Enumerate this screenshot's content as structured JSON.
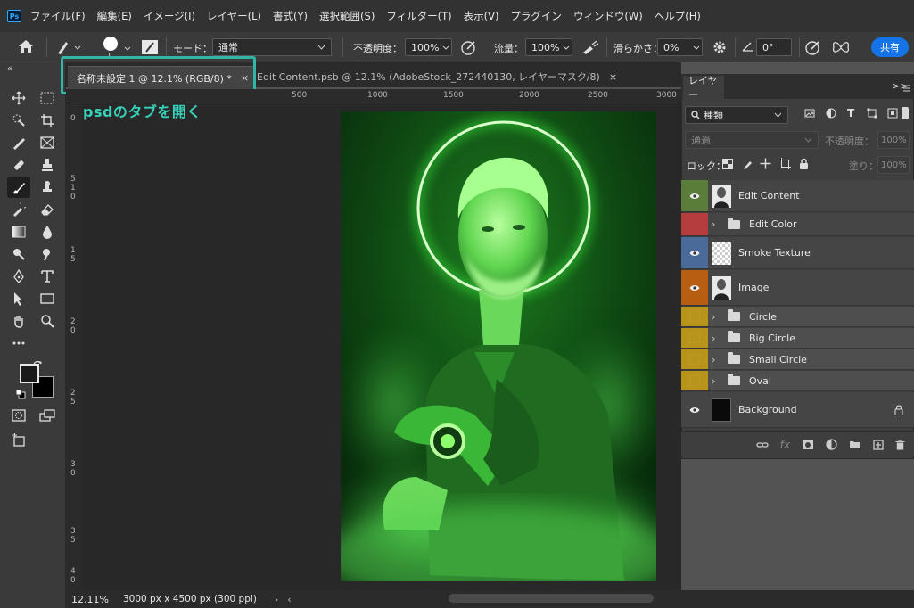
{
  "menubar": {
    "items": [
      "ファイル(F)",
      "編集(E)",
      "イメージ(I)",
      "レイヤー(L)",
      "書式(Y)",
      "選択範囲(S)",
      "フィルター(T)",
      "表示(V)",
      "プラグイン",
      "ウィンドウ(W)",
      "ヘルプ(H)"
    ],
    "logo_text": "Ps"
  },
  "options": {
    "brush_size": "1",
    "mode_label": "モード：",
    "mode_value": "通常",
    "opacity_label": "不透明度：",
    "opacity_value": "100%",
    "flow_label": "流量：",
    "flow_value": "100%",
    "smoothing_label": "滑らかさ：",
    "smoothing_value": "0%",
    "angle_value": "0°",
    "share_label": "共有"
  },
  "tabs": {
    "active": "名称未設定 1 @ 12.1% (RGB/8) *",
    "inactive": "Edit Content.psb @ 12.1% (AdobeStock_272440130, レイヤーマスク/8)",
    "close": "×",
    "collapse": "«"
  },
  "annotation": "psdのタブを開く",
  "ruler": {
    "top": [
      "500",
      "1000",
      "1500",
      "2000",
      "2500",
      "3000"
    ],
    "left": [
      "0",
      "5",
      "1",
      "0",
      "1",
      "5",
      "2",
      "0",
      "2",
      "5",
      "3",
      "0",
      "3",
      "5",
      "4",
      "0"
    ]
  },
  "status": {
    "zoom": "12.11%",
    "doc_info": "3000 px x 4500 px (300 ppi)",
    "arrow": "›",
    "left_arrow": "‹"
  },
  "layers_panel": {
    "title": "レイヤー",
    "menu": ">>",
    "filter_value": "種類",
    "blend_mode": "通過",
    "opacity_label": "不透明度：",
    "opacity_value": "100%",
    "lock_label": "ロック：",
    "fill_label": "塗り：",
    "fill_value": "100%",
    "layers": [
      {
        "name": "Edit Content",
        "color": "#5a7d3a",
        "type": "smart"
      },
      {
        "name": "Edit Color",
        "color": "#b53d3d",
        "type": "group"
      },
      {
        "name": "Smoke Texture",
        "color": "#4a6b9a",
        "type": "pixel"
      },
      {
        "name": "Image",
        "color": "#b85e12",
        "type": "smart"
      },
      {
        "name": "Circle",
        "color": "#b8951a",
        "type": "group"
      },
      {
        "name": "Big Circle",
        "color": "#b8951a",
        "type": "group"
      },
      {
        "name": "Small Circle",
        "color": "#b8951a",
        "type": "group"
      },
      {
        "name": "Oval",
        "color": "#b8951a",
        "type": "group"
      },
      {
        "name": "Background",
        "color": "#454545",
        "type": "locked"
      }
    ],
    "footer_fx": "fx"
  },
  "colors": {
    "accent_teal": "#2fb6a7",
    "share_blue": "#1473e6",
    "neon_green": "#39ff3a"
  }
}
